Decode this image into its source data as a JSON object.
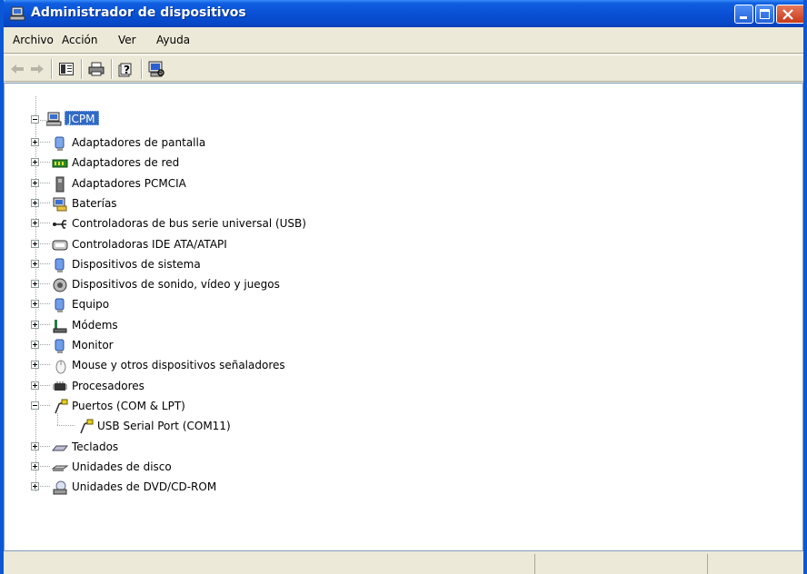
{
  "window": {
    "title": "Administrador de dispositivos",
    "colors": {
      "title_bar": "#0A50D5",
      "selection": "#316AC5",
      "background": "#ECE9D8"
    }
  },
  "menu": {
    "items": [
      "Archivo",
      "Acción",
      "Ver",
      "Ayuda"
    ]
  },
  "toolbar": {
    "buttons": [
      "back-icon",
      "forward-icon",
      "show-hide-tree-icon",
      "print-icon",
      "help-icon",
      "scan-hardware-icon"
    ]
  },
  "tree": {
    "root": "JCPM",
    "nodes": [
      {
        "label": "Adaptadores de pantalla",
        "icon": "display-adapter-icon",
        "expanded": false
      },
      {
        "label": "Adaptadores de red",
        "icon": "network-adapter-icon",
        "expanded": false
      },
      {
        "label": "Adaptadores PCMCIA",
        "icon": "pcmcia-icon",
        "expanded": false
      },
      {
        "label": "Baterías",
        "icon": "battery-icon",
        "expanded": false
      },
      {
        "label": "Controladoras de bus serie universal (USB)",
        "icon": "usb-icon",
        "expanded": false
      },
      {
        "label": "Controladoras IDE ATA/ATAPI",
        "icon": "ide-icon",
        "expanded": false
      },
      {
        "label": "Dispositivos de sistema",
        "icon": "system-device-icon",
        "expanded": false
      },
      {
        "label": "Dispositivos de sonido, vídeo y juegos",
        "icon": "sound-icon",
        "expanded": false
      },
      {
        "label": "Equipo",
        "icon": "computer-icon",
        "expanded": false
      },
      {
        "label": "Módems",
        "icon": "modem-icon",
        "expanded": false
      },
      {
        "label": "Monitor",
        "icon": "monitor-icon",
        "expanded": false
      },
      {
        "label": "Mouse y otros dispositivos señaladores",
        "icon": "mouse-icon",
        "expanded": false
      },
      {
        "label": "Procesadores",
        "icon": "processor-icon",
        "expanded": false
      },
      {
        "label": "Puertos (COM & LPT)",
        "icon": "port-icon",
        "expanded": true
      },
      {
        "label": "USB Serial Port (COM11)",
        "icon": "port-icon",
        "child": true
      },
      {
        "label": "Teclados",
        "icon": "keyboard-icon",
        "expanded": false
      },
      {
        "label": "Unidades de disco",
        "icon": "disk-drive-icon",
        "expanded": false
      },
      {
        "label": "Unidades de DVD/CD-ROM",
        "icon": "dvd-icon",
        "expanded": false
      }
    ]
  }
}
